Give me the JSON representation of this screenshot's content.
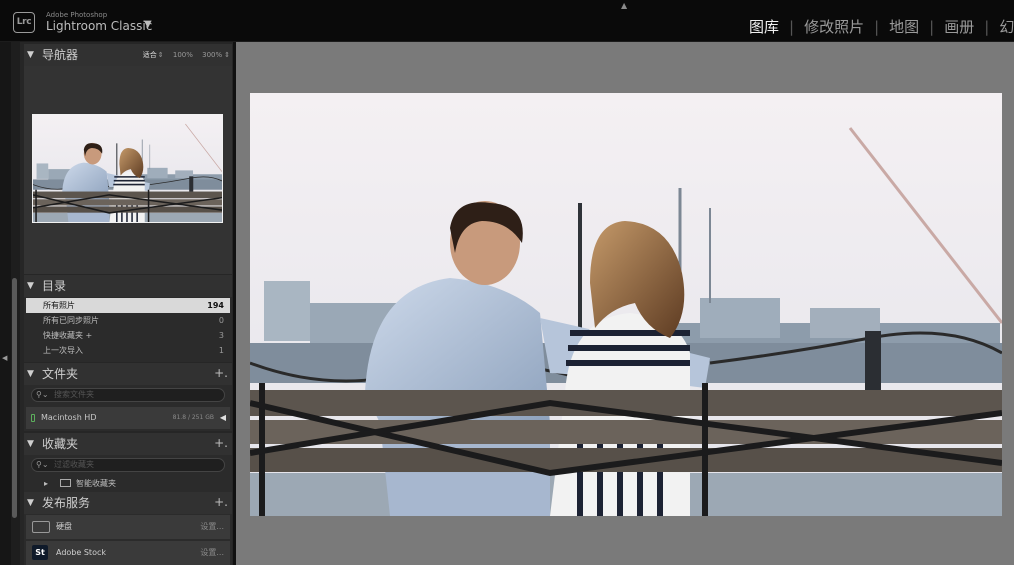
{
  "app": {
    "logo": "Lrc",
    "vendor": "Adobe Photoshop",
    "name": "Lightroom Classic",
    "caret": "▼",
    "modules": [
      {
        "label": "图库",
        "active": true
      },
      {
        "label": "修改照片",
        "active": false
      },
      {
        "label": "地图",
        "active": false
      },
      {
        "label": "画册",
        "active": false
      },
      {
        "label": "幻",
        "active": false
      }
    ],
    "module_separator": "|",
    "top_arrow": "▲"
  },
  "navigator": {
    "title": "导航器",
    "zoom_fit": "适合",
    "zoom_100": "100%",
    "zoom_300": "300%",
    "zoom_arrows": "⇕"
  },
  "catalog": {
    "title": "目录",
    "rows": [
      {
        "label": "所有照片",
        "count": "194",
        "selected": true
      },
      {
        "label": "所有已同步照片",
        "count": "0",
        "selected": false
      },
      {
        "label": "快捷收藏夹 +",
        "count": "3",
        "selected": false
      },
      {
        "label": "上一次导入",
        "count": "1",
        "selected": false
      }
    ]
  },
  "folders": {
    "title": "文件夹",
    "plus": "+.",
    "search_placeholder": "搜索文件夹",
    "volume_name": "Macintosh HD",
    "volume_size": "81.8 / 251 GB",
    "volume_arrow": "◀"
  },
  "collections": {
    "title": "收藏夹",
    "plus": "+.",
    "search_placeholder": "过滤收藏夹",
    "smart_label": "智能收藏夹",
    "smart_arrow": "▸"
  },
  "publish": {
    "title": "发布服务",
    "plus": "+.",
    "services": [
      {
        "label": "硬盘",
        "action": "设置..."
      },
      {
        "label": "Adobe Stock",
        "action": "设置...",
        "icon_text": "St"
      }
    ]
  },
  "panel_triangle": "▼",
  "strip_arrow": "◀",
  "colors": {
    "accent_selected_row": "#d9d9d9",
    "main_background": "#7a7a7a",
    "panel_background": "#262626",
    "volume_indicator": "#5cae5c"
  }
}
